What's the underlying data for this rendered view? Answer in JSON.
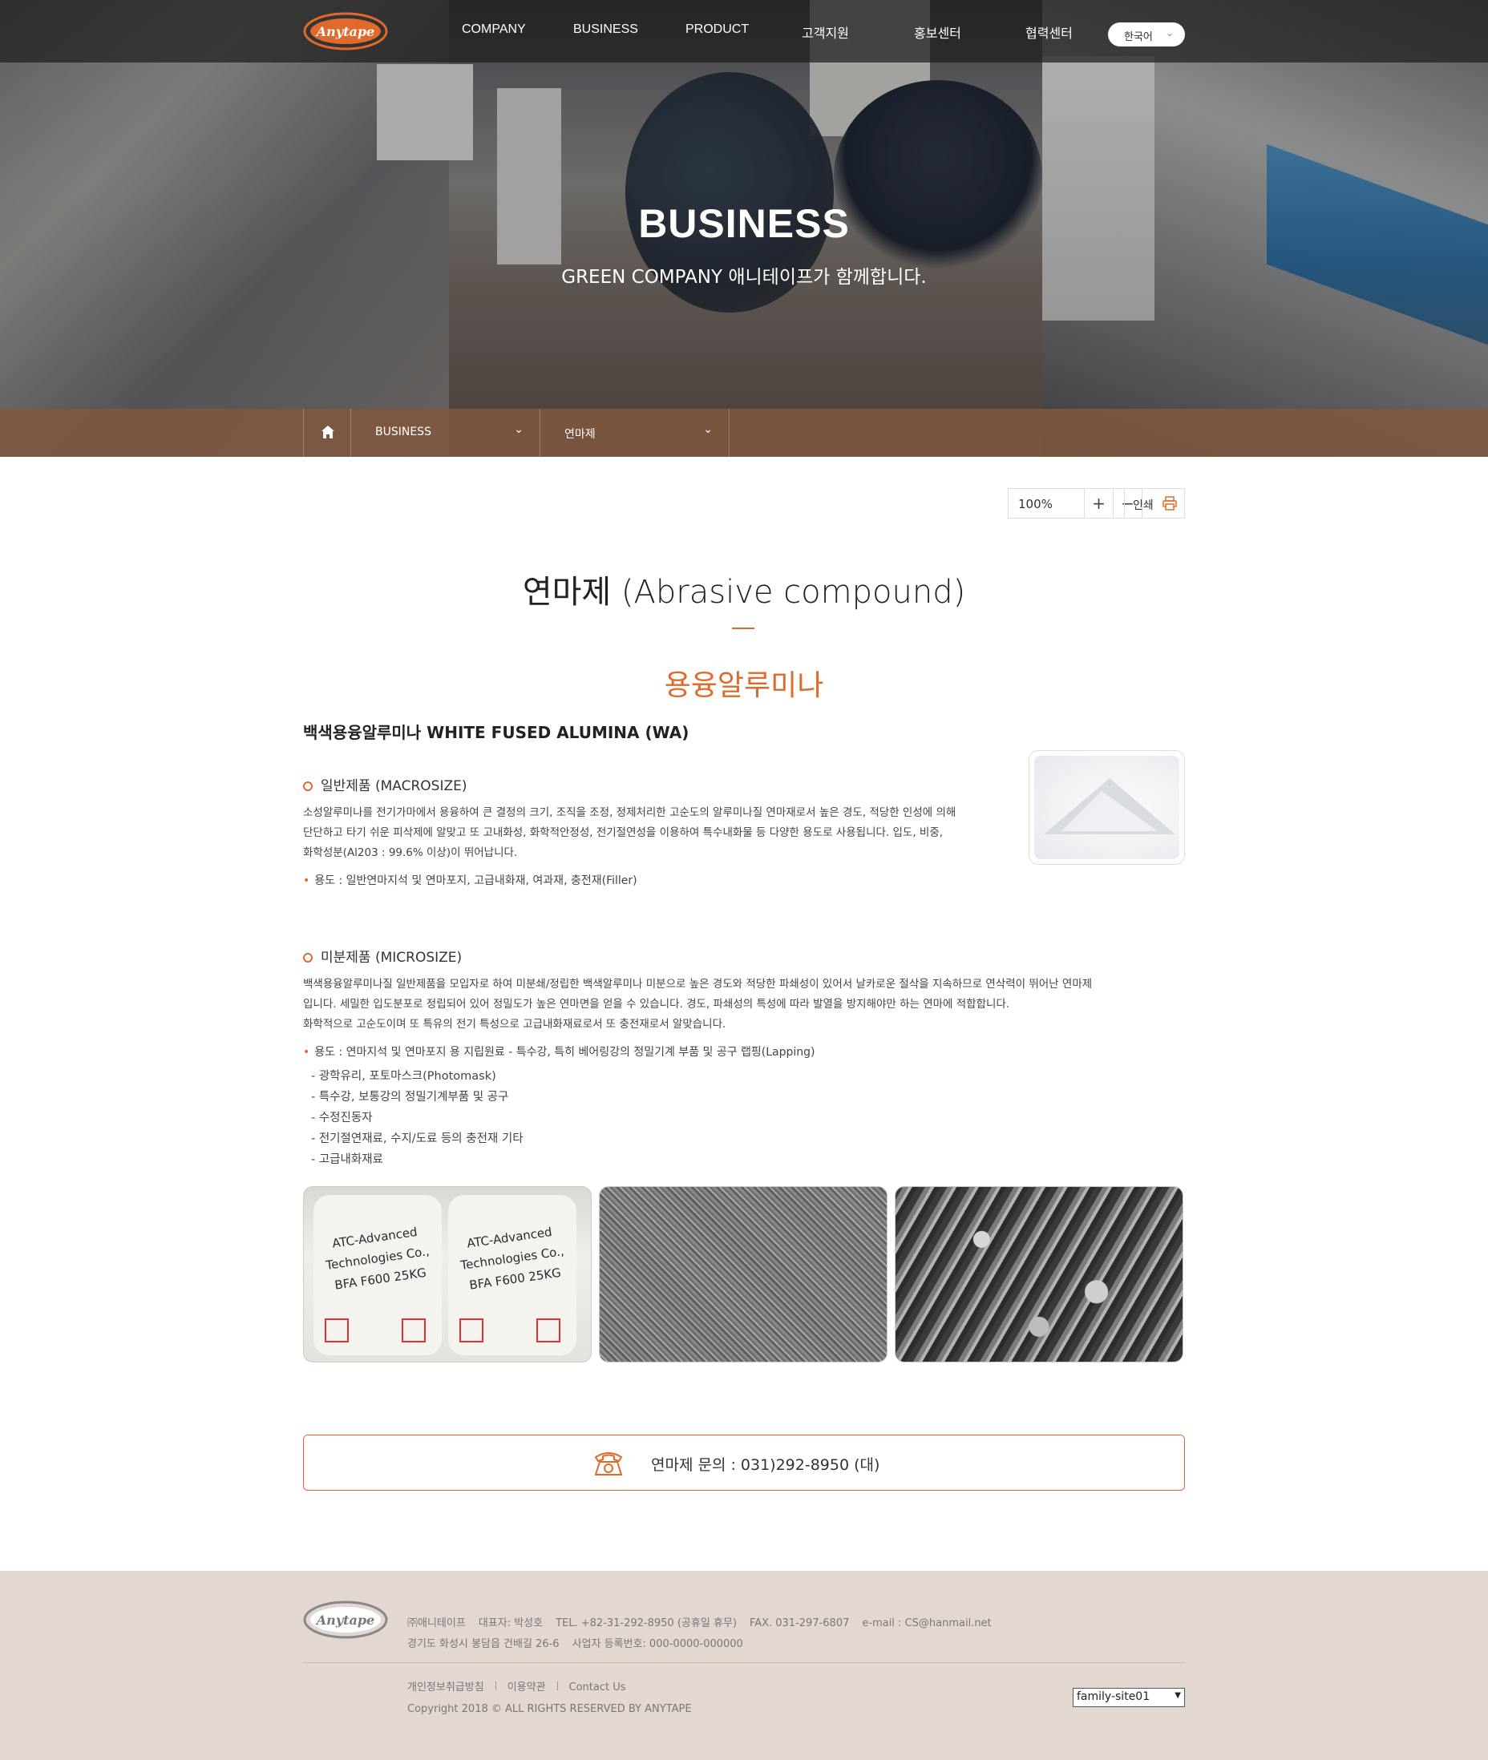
{
  "header": {
    "logo_text": "Anytape",
    "nav": [
      "COMPANY",
      "BUSINESS",
      "PRODUCT",
      "고객지원",
      "홍보센터",
      "협력센터"
    ],
    "language": "한국어"
  },
  "hero": {
    "title": "BUSINESS",
    "subtitle": "GREEN COMPANY 애니테이프가 함께합니다."
  },
  "breadcrumb": {
    "home_icon": "home-icon",
    "level1": "BUSINESS",
    "level2": "연마제"
  },
  "tools": {
    "zoom": "100%",
    "zoom_in": "+",
    "zoom_out": "−",
    "print": "인쇄"
  },
  "content": {
    "page_title": "연마제 (Abrasive compound)",
    "section_title": "용융알루미나",
    "product_title": "백색용융알루미나 WHITE FUSED ALUMINA (WA)",
    "macro": {
      "heading": "일반제품 (MACROSIZE)",
      "lines": [
        "소성알루미나를 전기가마에서 용융하여 큰 결정의 크기, 조직을 조정, 정제처리한 고순도의 알루미나질 연마재로서 높은 경도, 적당한 인성에 의해",
        "단단하고 타기 쉬운 피삭제에 알맞고 또 고내화성, 화학적안정성, 전기절연성을 이용하여 특수내화물 등 다양한 용도로 사용됩니다. 입도, 비중,",
        "화학성분(Al203 : 99.6% 이상)이 뛰어납니다."
      ],
      "usage": "용도 : 일반연마지석 및 연마포지, 고급내화재, 여과재, 충전재(Filler)"
    },
    "micro": {
      "heading": "미분제품 (MICROSIZE)",
      "lines": [
        "백색용융알루미나질 일반제품을 모입자로 하여 미분쇄/정립한 백색알루미나 미분으로 높은 경도와 적당한 파쇄성이 있어서 날카로운 절삭을 지속하므로 연삭력이 뛰어난 연마제",
        "입니다. 세밀한 입도분포로 정립되어 있어 정밀도가 높은 연마면을 얻을 수 있습니다. 경도, 파쇄성의 특성에 따라 발열을 방지해야만 하는 연마에 적합합니다.",
        "화학적으로 고순도이며 또 특유의 전기 특성으로 고급내화재료로서 또 충전재로서 알맞습니다."
      ],
      "usage": "용도 : 연마지석 및 연마포지 용 지립원료 - 특수강, 특히 베어링강의 정밀기계 부품 및 공구 랩핑(Lapping)",
      "sublist": [
        "- 광학유리, 포토마스크(Photomask)",
        "- 특수강, 보통강의 정밀기계부품 및 공구",
        "- 수정진동자",
        "- 전기절연재료, 수지/도료 등의 충전재 기타",
        "- 고급내화재료"
      ]
    },
    "bag_text": {
      "line1": "ATC-Advanced",
      "line2": "Technologies Co.,",
      "line3": "BFA F600  25KG"
    },
    "contact": "연마제 문의 : 031)292-8950 (대)"
  },
  "footer": {
    "company": "㈜애니테이프",
    "ceo": "대표자: 박성호",
    "tel": "TEL. +82-31-292-8950 (공휴일 휴무)",
    "fax": "FAX. 031-297-6807",
    "email": "e-mail : CS@hanmail.net",
    "address": "경기도 화성시 봉담읍 건배길 26-6",
    "bizno": "사업자 등록번호: 000-0000-000000",
    "links": [
      "개인정보취급방침",
      "이용약관",
      "Contact Us"
    ],
    "copyright": "Copyright 2018 © ALL RIGHTS RESERVED BY ANYTAPE",
    "family_site": "family-site01"
  },
  "colors": {
    "accent": "#e06a2c",
    "breadcrumb_bg": "#805840",
    "footer_bg": "#e2d7d1"
  }
}
